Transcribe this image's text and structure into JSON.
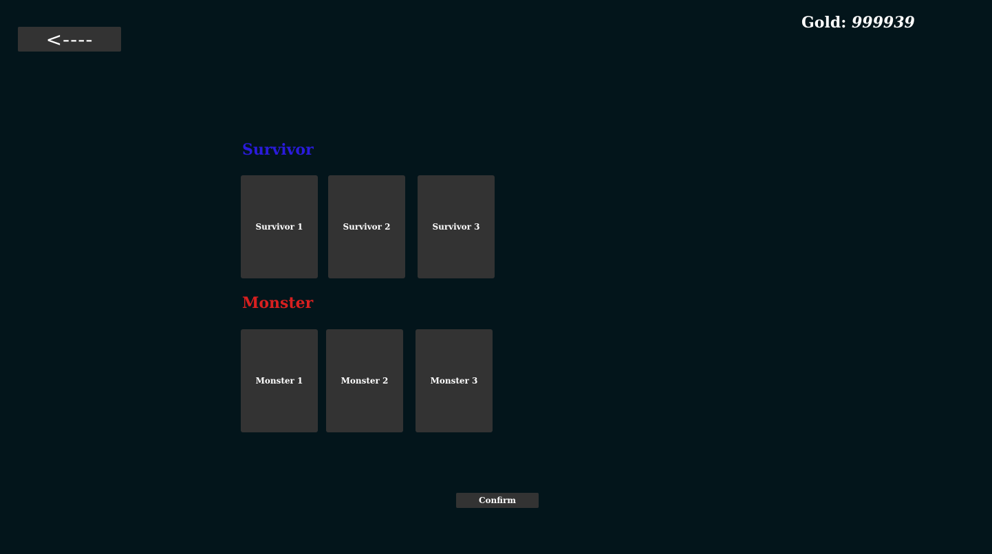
{
  "header": {
    "back_label": "<----",
    "gold_label": "Gold:",
    "gold_value": "999939"
  },
  "survivor": {
    "title": "Survivor",
    "title_color": "#2a1bdc",
    "cards": [
      {
        "label": "Survivor 1"
      },
      {
        "label": "Survivor 2"
      },
      {
        "label": "Survivor 3"
      }
    ]
  },
  "monster": {
    "title": "Monster",
    "title_color": "#d82020",
    "cards": [
      {
        "label": "Monster 1"
      },
      {
        "label": "Monster 2"
      },
      {
        "label": "Monster 3"
      }
    ]
  },
  "footer": {
    "confirm_label": "Confirm"
  },
  "colors": {
    "background": "#03151b",
    "panel": "#333333",
    "text": "#ffffff"
  }
}
